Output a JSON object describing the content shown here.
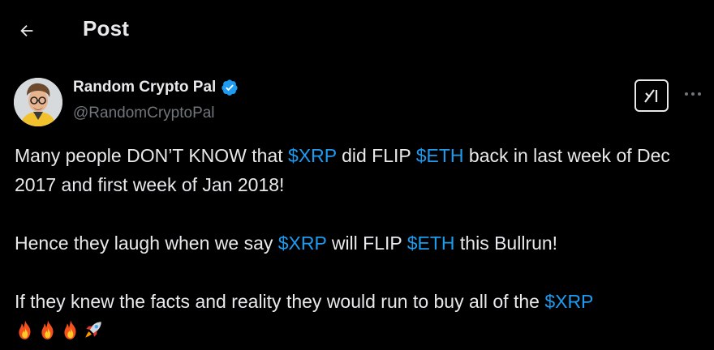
{
  "header": {
    "title": "Post"
  },
  "author": {
    "display_name": "Random Crypto Pal",
    "handle": "@RandomCryptoPal"
  },
  "post": {
    "line1_part1": "Many people DON’T KNOW that ",
    "line1_tag1": "$XRP",
    "line1_part2": " did FLIP ",
    "line1_tag2": "$ETH",
    "line1_part3": " back in last week of Dec 2017 and first week of Jan 2018!",
    "line2_part1": "Hence they laugh when we say ",
    "line2_tag1": "$XRP",
    "line2_part2": " will FLIP ",
    "line2_tag2": "$ETH",
    "line2_part3": " this Bullrun!",
    "line3_part1": "If they knew the facts and reality they would run to buy all of the ",
    "line3_tag1": "$XRP",
    "emojis": [
      "fire",
      "fire",
      "fire",
      "rocket"
    ]
  },
  "colors": {
    "background": "#000000",
    "text": "#e7e9ea",
    "secondary_text": "#71767b",
    "cashtag": "#1d9bf0",
    "verified_badge": "#1d9bf0"
  },
  "icons": [
    "back-arrow-icon",
    "verified-badge-icon",
    "grok-icon",
    "more-icon"
  ]
}
